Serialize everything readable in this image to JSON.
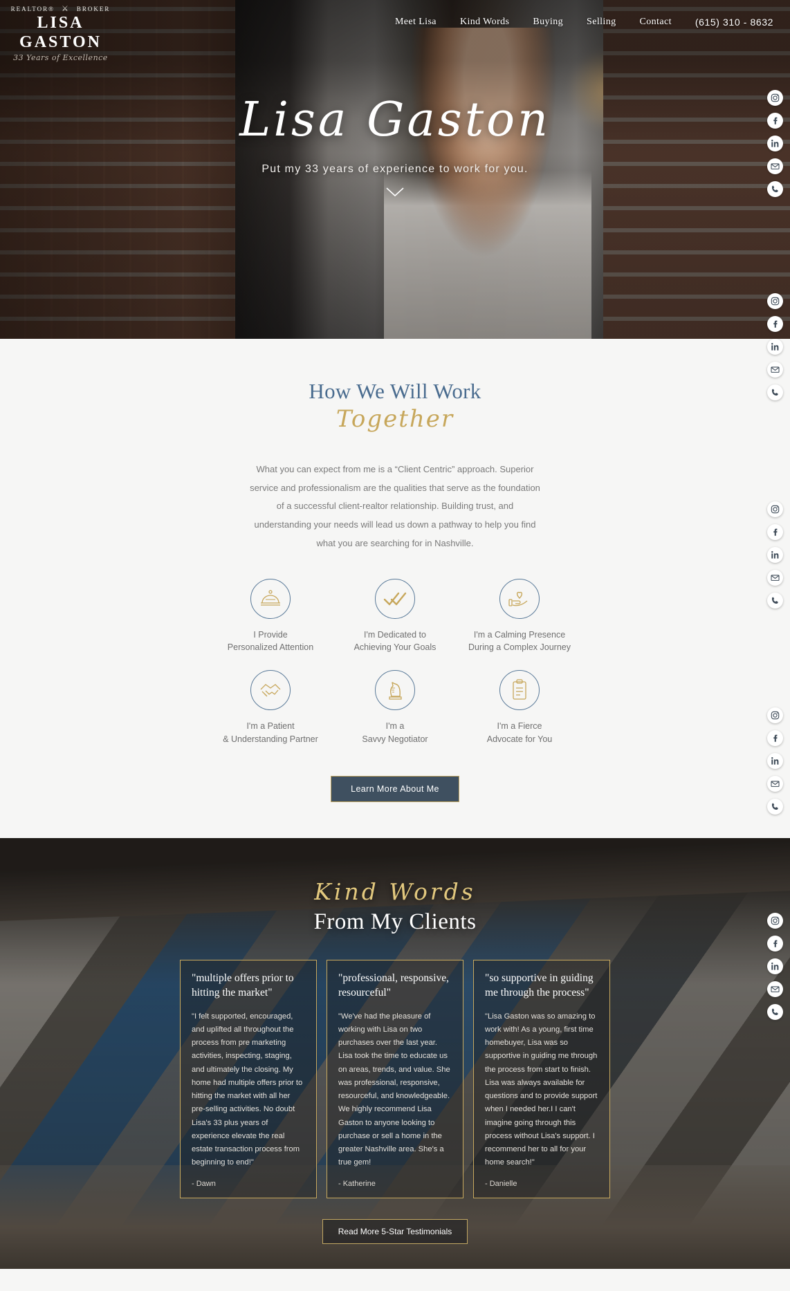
{
  "header": {
    "logo": {
      "eyebrow_left": "REALTOR®",
      "eyebrow_right": "BROKER",
      "crest_icon": "crest-icon",
      "name": "LISA GASTON",
      "tagline": "33 Years of Excellence"
    },
    "nav_items": [
      {
        "label": "Meet Lisa"
      },
      {
        "label": "Kind Words"
      },
      {
        "label": "Buying"
      },
      {
        "label": "Selling"
      },
      {
        "label": "Contact"
      }
    ],
    "phone": "(615) 310 - 8632"
  },
  "hero": {
    "title": "Lisa Gaston",
    "subtitle": "Put my 33 years of experience to work for you.",
    "scroll_icon": "chevron-down-icon"
  },
  "social": {
    "items": [
      {
        "name": "instagram-icon"
      },
      {
        "name": "facebook-icon"
      },
      {
        "name": "linkedin-icon"
      },
      {
        "name": "email-icon"
      },
      {
        "name": "phone-icon"
      }
    ]
  },
  "work": {
    "heading_line1": "How We Will Work",
    "heading_line2": "Together",
    "paragraph": "What you can expect from me is a “Client Centric” approach. Superior service and professionalism are the qualities that serve as the foundation of a successful client-realtor relationship. Building trust, and understanding your needs will lead us down a pathway to help you find what you are searching for in Nashville.",
    "features": [
      {
        "icon": "service-dome-icon",
        "line1": "I Provide",
        "line2": "Personalized Attention"
      },
      {
        "icon": "double-check-icon",
        "line1": "I'm Dedicated to",
        "line2": "Achieving Your Goals"
      },
      {
        "icon": "hand-heart-icon",
        "line1": "I'm a Calming Presence",
        "line2": "During a Complex Journey"
      },
      {
        "icon": "handshake-icon",
        "line1": "I'm a Patient",
        "line2": "& Understanding Partner"
      },
      {
        "icon": "chess-knight-icon",
        "line1": "I'm a",
        "line2": "Savvy Negotiator"
      },
      {
        "icon": "clipboard-icon",
        "line1": "I'm a Fierce",
        "line2": "Advocate for You"
      }
    ],
    "cta_label": "Learn More About Me"
  },
  "testimonials": {
    "heading_line1": "Kind Words",
    "heading_line2": "From My Clients",
    "cards": [
      {
        "title": "\"multiple offers prior to hitting the market\"",
        "body": "\"I felt supported, encouraged, and uplifted all throughout the process from pre marketing activities, inspecting, staging, and ultimately the closing.  My home had multiple offers prior to hitting the market with all her pre-selling activities.   No doubt Lisa's 33 plus years of experience elevate the real estate transaction process from beginning to end!\"",
        "author": "- Dawn"
      },
      {
        "title": "\"professional, responsive, resourceful\"",
        "body": "\"We've had the pleasure of working with Lisa on two purchases over the last year. Lisa took the time to educate us on areas, trends, and value. She was professional, responsive, resourceful, and knowledgeable. We highly recommend Lisa Gaston to anyone looking to purchase or sell a home in the greater Nashville area. She's a true gem!",
        "author": "- Katherine"
      },
      {
        "title": "\"so supportive in guiding me through the process\"",
        "body": "\"Lisa Gaston was so amazing to work with! As a young, first time homebuyer, Lisa was so supportive in guiding me through the process from start to finish. Lisa was always available for questions and to provide support when I needed her.I I can't imagine going through this process without Lisa's support. I recommend her to all for your home search!\"",
        "author": "- Danielle"
      }
    ],
    "cta_label": "Read More 5-Star Testimonials"
  },
  "colors": {
    "gold": "#c7a75b",
    "blue": "#4a6c8f",
    "slate": "#3f5060",
    "page_bg": "#f6f6f5"
  }
}
